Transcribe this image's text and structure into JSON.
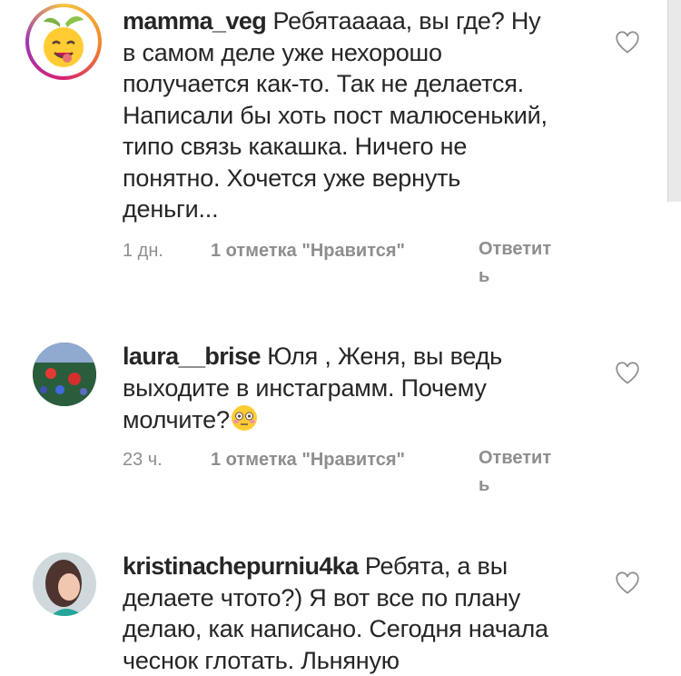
{
  "comments": [
    {
      "username": "mamma_veg",
      "text": "Ребятааааа, вы где? Ну в самом деле уже нехорошо получается как-то. Так не делается. Написали бы хоть пост малюсенький, типо связь какашка. Ничего не понятно. Хочется уже вернуть деньги...",
      "time": "1 дн.",
      "likes": "1 отметка \"Нравится\"",
      "reply": "Ответить",
      "avatar_icon": "smiley-face-avatar"
    },
    {
      "username": "laura__brise",
      "text": "Юля , Женя, вы ведь выходите в инстаграмм. Почему молчите?",
      "emoji": "flushed-face-emoji",
      "time": "23 ч.",
      "likes": "1 отметка \"Нравится\"",
      "reply": "Ответить",
      "avatar_icon": "poppy-field-avatar"
    },
    {
      "username": "kristinachepurniu4ka",
      "text": "Ребята, а вы делаете чтото?) Я вот все по плану делаю, как написано. Сегодня начала чеснок глотать. Льняную",
      "avatar_icon": "woman-photo-avatar"
    }
  ],
  "colors": {
    "text": "#262626",
    "muted": "#8e8e8e",
    "heart": "#8e8e8e"
  }
}
